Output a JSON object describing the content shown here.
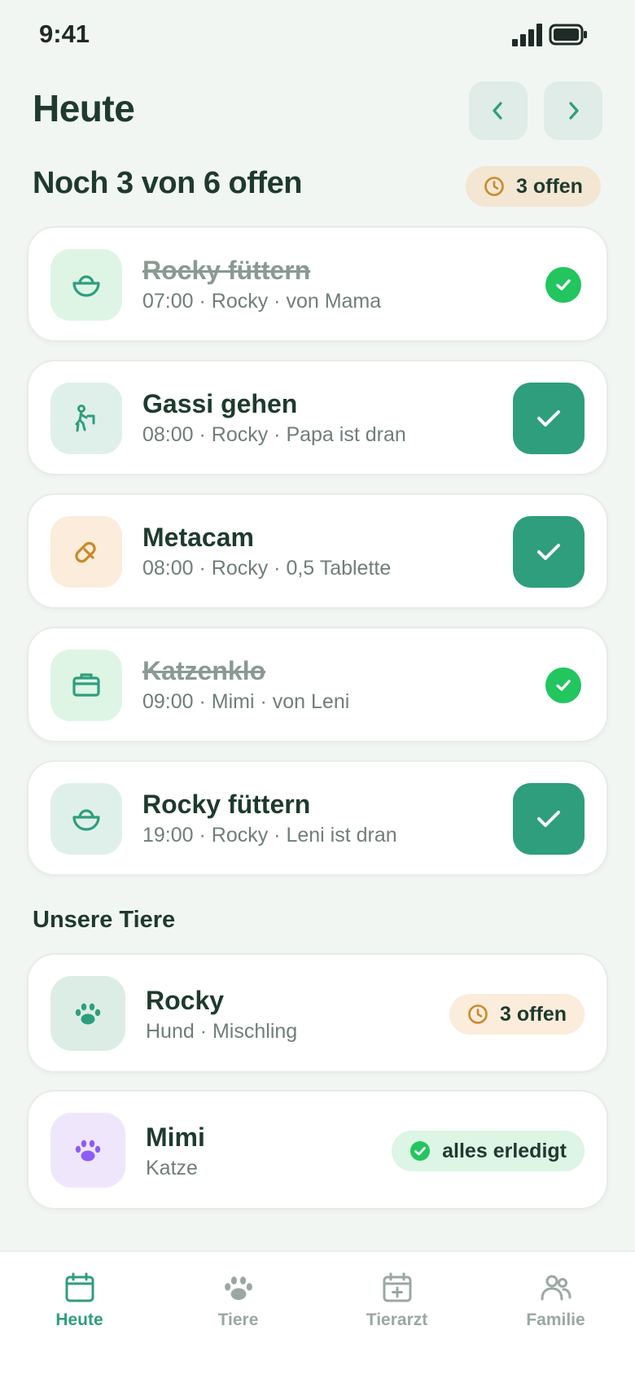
{
  "status_bar": {
    "time": "9:41"
  },
  "header": {
    "title": "Heute"
  },
  "summary": {
    "title": "Noch 3 von 6 offen",
    "badge": "3 offen"
  },
  "tasks": [
    {
      "title": "Rocky füttern",
      "subtitle": "07:00 · Rocky · von Mama",
      "done": true,
      "icon": "bowl-icon"
    },
    {
      "title": "Gassi gehen",
      "subtitle": "08:00 · Rocky · Papa ist dran",
      "done": false,
      "icon": "walking-icon"
    },
    {
      "title": "Metacam",
      "subtitle": "08:00 · Rocky · 0,5 Tablette",
      "done": false,
      "icon": "pill-icon"
    },
    {
      "title": "Katzenklo",
      "subtitle": "09:00 · Mimi · von Leni",
      "done": true,
      "icon": "litter-box-icon"
    },
    {
      "title": "Rocky füttern",
      "subtitle": "19:00 · Rocky · Leni ist dran",
      "done": false,
      "icon": "bowl-icon"
    }
  ],
  "pets_section": {
    "title": "Unsere Tiere"
  },
  "pets": [
    {
      "name": "Rocky",
      "subtitle": "Hund · Mischling",
      "badge": "3 offen",
      "icon": "paw-icon"
    },
    {
      "name": "Mimi",
      "subtitle": "Katze",
      "badge": "alles erledigt",
      "icon": "paw-icon"
    }
  ],
  "tabs": [
    {
      "label": "Heute",
      "icon": "calendar-icon",
      "active": true
    },
    {
      "label": "Tiere",
      "icon": "paw-icon",
      "active": false
    },
    {
      "label": "Tierarzt",
      "icon": "calendar-plus-icon",
      "active": false
    },
    {
      "label": "Familie",
      "icon": "people-icon",
      "active": false
    }
  ],
  "colors": {
    "accent": "#2e9e7d",
    "done_green": "#22c55e",
    "pending_badge": "#f3e6d2",
    "done_badge": "#dcf5e4",
    "text_dark": "#1e3a2e",
    "text_muted": "#6f7f77"
  }
}
